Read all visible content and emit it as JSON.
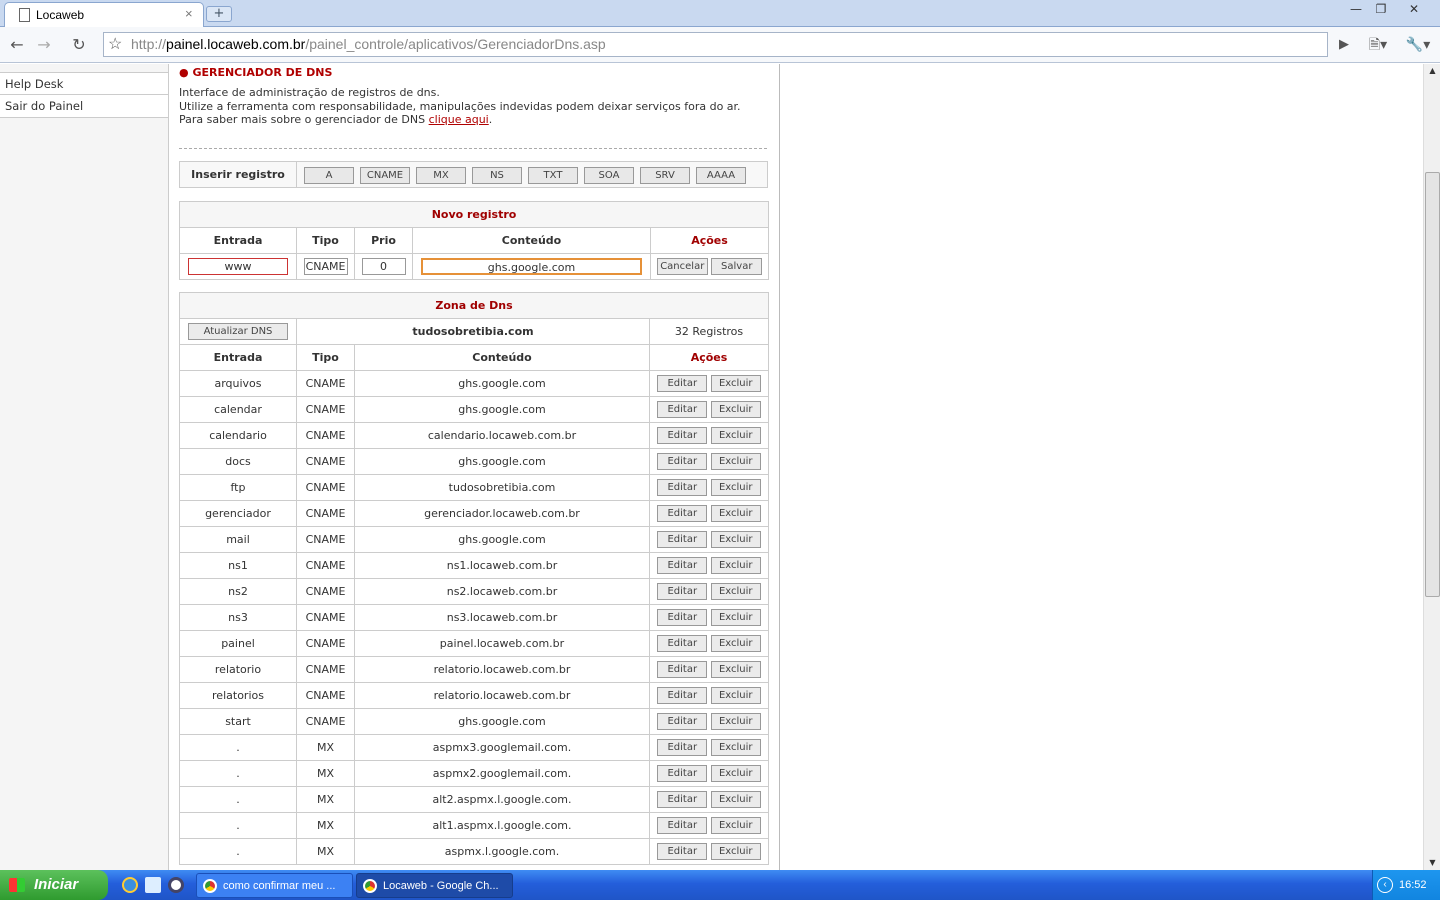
{
  "browser": {
    "tab_title": "Locaweb",
    "tab_close": "×",
    "new_tab": "+",
    "url_prefix": "http://",
    "url_domain": "painel.locaweb.com.br",
    "url_path": "/painel_controle/aplicativos/GerenciadorDns.asp",
    "window_buttons": [
      "—",
      "❐",
      "✕"
    ]
  },
  "sidebar": {
    "items": [
      "Help Desk",
      "Sair do Painel"
    ]
  },
  "page": {
    "heading": "GERENCIADOR DE DNS",
    "intro_line1": "Interface de administração de registros de dns.",
    "intro_line2": "Utilize a ferramenta com responsabilidade, manipulações indevidas podem deixar serviços fora do ar.",
    "intro_line3": "Para saber mais sobre o gerenciador de DNS ",
    "intro_link": "clique aqui",
    "intro_end": "."
  },
  "insert_bar": {
    "label": "Inserir registro",
    "types": [
      "A",
      "CNAME",
      "MX",
      "NS",
      "TXT",
      "SOA",
      "SRV",
      "AAAA"
    ]
  },
  "new_record": {
    "title": "Novo registro",
    "headers": [
      "Entrada",
      "Tipo",
      "Prio",
      "Conteúdo",
      "Ações"
    ],
    "entrada": "www",
    "tipo": "CNAME",
    "prio": "0",
    "conteudo": "ghs.google.com",
    "cancel_label": "Cancelar",
    "save_label": "Salvar"
  },
  "zone": {
    "title": "Zona de Dns",
    "refresh_label": "Atualizar DNS",
    "domain": "tudosobretibia.com",
    "count": "32 Registros",
    "headers": [
      "Entrada",
      "Tipo",
      "Conteúdo",
      "Ações"
    ],
    "edit_label": "Editar",
    "delete_label": "Excluir",
    "records": [
      {
        "entrada": "arquivos",
        "tipo": "CNAME",
        "conteudo": "ghs.google.com"
      },
      {
        "entrada": "calendar",
        "tipo": "CNAME",
        "conteudo": "ghs.google.com"
      },
      {
        "entrada": "calendario",
        "tipo": "CNAME",
        "conteudo": "calendario.locaweb.com.br"
      },
      {
        "entrada": "docs",
        "tipo": "CNAME",
        "conteudo": "ghs.google.com"
      },
      {
        "entrada": "ftp",
        "tipo": "CNAME",
        "conteudo": "tudosobretibia.com"
      },
      {
        "entrada": "gerenciador",
        "tipo": "CNAME",
        "conteudo": "gerenciador.locaweb.com.br"
      },
      {
        "entrada": "mail",
        "tipo": "CNAME",
        "conteudo": "ghs.google.com"
      },
      {
        "entrada": "ns1",
        "tipo": "CNAME",
        "conteudo": "ns1.locaweb.com.br"
      },
      {
        "entrada": "ns2",
        "tipo": "CNAME",
        "conteudo": "ns2.locaweb.com.br"
      },
      {
        "entrada": "ns3",
        "tipo": "CNAME",
        "conteudo": "ns3.locaweb.com.br"
      },
      {
        "entrada": "painel",
        "tipo": "CNAME",
        "conteudo": "painel.locaweb.com.br"
      },
      {
        "entrada": "relatorio",
        "tipo": "CNAME",
        "conteudo": "relatorio.locaweb.com.br"
      },
      {
        "entrada": "relatorios",
        "tipo": "CNAME",
        "conteudo": "relatorio.locaweb.com.br"
      },
      {
        "entrada": "start",
        "tipo": "CNAME",
        "conteudo": "ghs.google.com"
      },
      {
        "entrada": ".",
        "tipo": "MX",
        "conteudo": "aspmx3.googlemail.com."
      },
      {
        "entrada": ".",
        "tipo": "MX",
        "conteudo": "aspmx2.googlemail.com."
      },
      {
        "entrada": ".",
        "tipo": "MX",
        "conteudo": "alt2.aspmx.l.google.com."
      },
      {
        "entrada": ".",
        "tipo": "MX",
        "conteudo": "alt1.aspmx.l.google.com."
      },
      {
        "entrada": ".",
        "tipo": "MX",
        "conteudo": "aspmx.l.google.com."
      }
    ]
  },
  "taskbar": {
    "start_label": "Iniciar",
    "tasks": [
      "como confirmar meu ...",
      "Locaweb - Google Ch..."
    ],
    "clock": "16:52"
  }
}
